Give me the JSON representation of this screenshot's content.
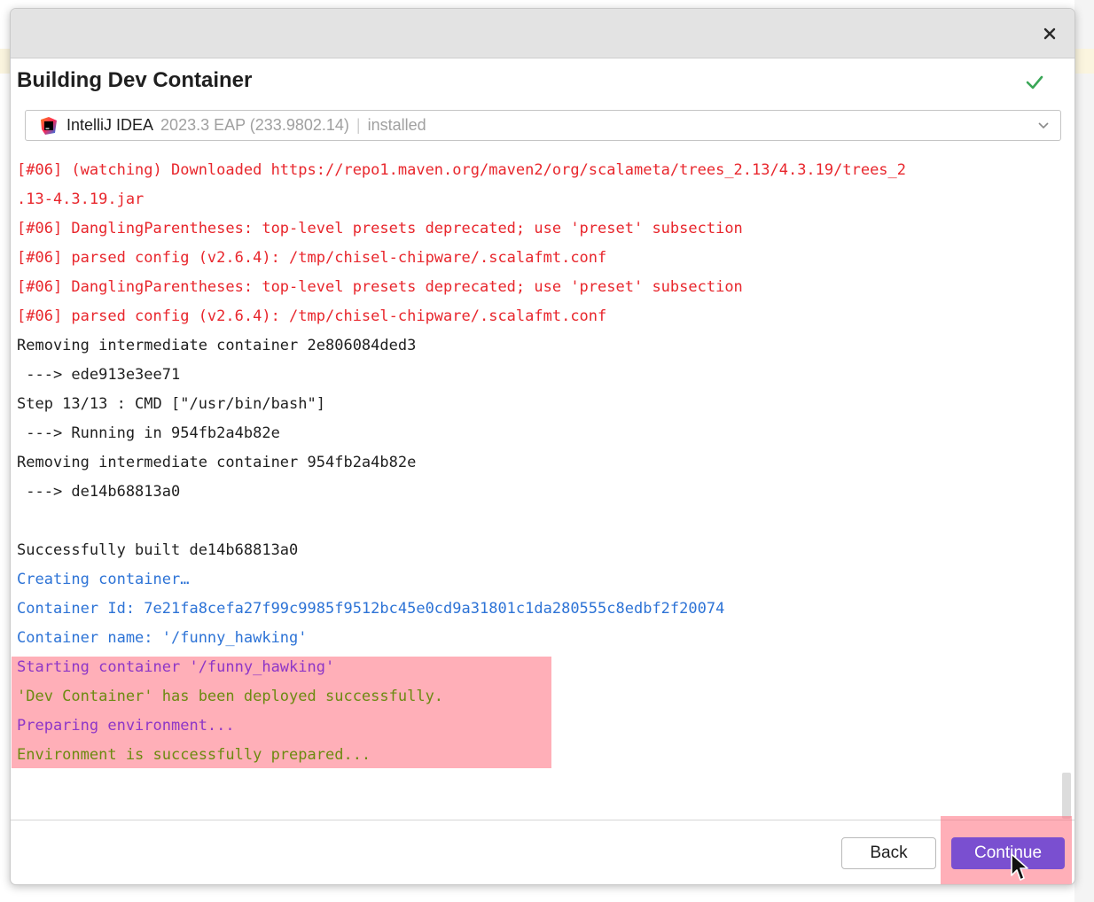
{
  "dialog": {
    "title": "Building Dev Container",
    "status_icon": "check-icon"
  },
  "ide_selector": {
    "name": "IntelliJ IDEA",
    "version": "2023.3 EAP (233.9802.14)",
    "separator": "|",
    "status": "installed"
  },
  "log_lines": [
    {
      "text": "[#06] (watching) Downloaded https://repo1.maven.org/maven2/org/scalameta/trees_2.13/4.3.19/trees_2",
      "color": "#e8262c"
    },
    {
      "text": ".13-4.3.19.jar",
      "color": "#e8262c"
    },
    {
      "text": "[#06] DanglingParentheses: top-level presets deprecated; use 'preset' subsection",
      "color": "#e8262c"
    },
    {
      "text": "[#06] parsed config (v2.6.4): /tmp/chisel-chipware/.scalafmt.conf",
      "color": "#e8262c"
    },
    {
      "text": "[#06] DanglingParentheses: top-level presets deprecated; use 'preset' subsection",
      "color": "#e8262c"
    },
    {
      "text": "[#06] parsed config (v2.6.4): /tmp/chisel-chipware/.scalafmt.conf",
      "color": "#e8262c"
    },
    {
      "text": "Removing intermediate container 2e806084ded3",
      "color": "#1f1f1f"
    },
    {
      "text": " ---> ede913e3ee71",
      "color": "#1f1f1f"
    },
    {
      "text": "Step 13/13 : CMD [\"/usr/bin/bash\"]",
      "color": "#1f1f1f"
    },
    {
      "text": " ---> Running in 954fb2a4b82e",
      "color": "#1f1f1f"
    },
    {
      "text": "Removing intermediate container 954fb2a4b82e",
      "color": "#1f1f1f"
    },
    {
      "text": " ---> de14b68813a0",
      "color": "#1f1f1f"
    },
    {
      "text": "",
      "color": "#1f1f1f"
    },
    {
      "text": "Successfully built de14b68813a0",
      "color": "#1f1f1f"
    },
    {
      "text": "Creating container…",
      "color": "#2d73d6"
    },
    {
      "text": "Container Id: 7e21fa8cefa27f99c9985f9512bc45e0cd9a31801c1da280555c8edbf2f20074",
      "color": "#2d73d6"
    },
    {
      "text": "Container name: '/funny_hawking'",
      "color": "#2d73d6"
    },
    {
      "text": "Starting container '/funny_hawking'",
      "color": "#8e36c7"
    },
    {
      "text": "'Dev Container' has been deployed successfully.",
      "color": "#6c8a10"
    },
    {
      "text": "Preparing environment...",
      "color": "#8e36c7"
    },
    {
      "text": "Environment is successfully prepared...",
      "color": "#6c8a10"
    }
  ],
  "footer": {
    "back_label": "Back",
    "continue_label": "Continue"
  },
  "colors": {
    "accent": "#7a4fd0",
    "success": "#3aa757",
    "error": "#e8262c",
    "info": "#2d73d6",
    "highlight": "#ff6e7d"
  }
}
